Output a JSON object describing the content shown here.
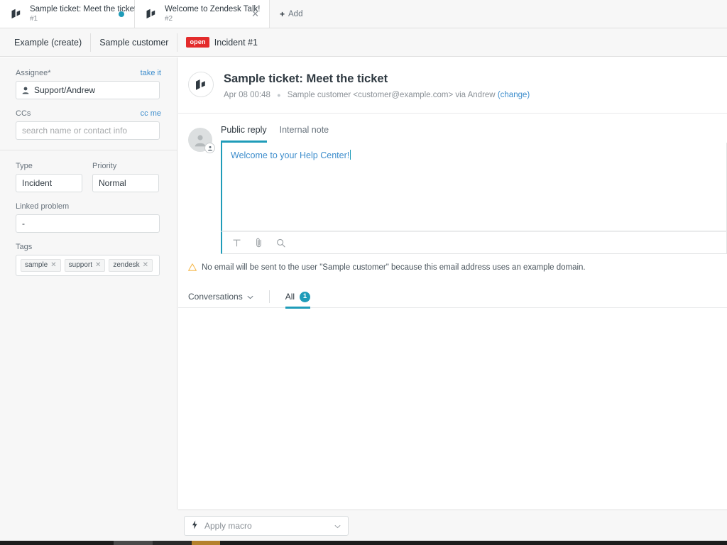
{
  "tabs": [
    {
      "title": "Sample ticket: Meet the ticket",
      "number": "#1",
      "icon": "ticket-icon",
      "state": "active",
      "indicator": "unsaved-dot"
    },
    {
      "title": "Welcome to Zendesk Talk!",
      "number": "#2",
      "icon": "ticket-icon",
      "state": "inactive",
      "indicator": "close-icon"
    }
  ],
  "add_tab": {
    "label": "Add",
    "icon": "plus-icon"
  },
  "breadcrumbs": [
    {
      "label": "Example (create)",
      "badge": null
    },
    {
      "label": "Sample customer",
      "badge": null
    },
    {
      "label": "Incident #1",
      "badge": "open"
    }
  ],
  "sidebar": {
    "assignee": {
      "label": "Assignee*",
      "action": "take it",
      "value": "Support/Andrew",
      "icon": "person-icon"
    },
    "ccs": {
      "label": "CCs",
      "action": "cc me",
      "value": "",
      "placeholder": "search name or contact info"
    },
    "type": {
      "label": "Type",
      "value": "Incident"
    },
    "priority": {
      "label": "Priority",
      "value": "Normal"
    },
    "linked_problem": {
      "label": "Linked problem",
      "value": "-"
    },
    "tags": {
      "label": "Tags",
      "chips": [
        "sample",
        "support",
        "zendesk"
      ]
    }
  },
  "ticket": {
    "title": "Sample ticket: Meet the ticket",
    "timestamp": "Apr 08 00:48",
    "requester": "Sample customer <customer@example.com> via Andrew",
    "change_link": "(change)",
    "avatar_icon": "ticket-icon"
  },
  "composer": {
    "tabs": [
      {
        "label": "Public reply",
        "active": true
      },
      {
        "label": "Internal note",
        "active": false
      }
    ],
    "body_text": "Welcome to your Help Center!",
    "toolbar_icons": [
      "text-format-icon",
      "attachment-icon",
      "search-icon"
    ],
    "avatar_icon": "user-avatar-icon",
    "avatar_badge_icon": "end-user-icon"
  },
  "warning": {
    "icon": "warning-triangle-icon",
    "text": "No email will be sent to the user \"Sample customer\" because this email address uses an example domain."
  },
  "conversations": {
    "selector_label": "Conversations",
    "selector_icon": "chevron-down-icon",
    "tab_label": "All",
    "tab_count": "1"
  },
  "footer": {
    "macro": {
      "label": "Apply macro",
      "icon": "lightning-icon",
      "chevron": "chevron-down-icon"
    }
  },
  "colors": {
    "accent_teal": "#1f9cb9",
    "link_blue": "#3d8dcc",
    "open_red": "#e32b2b",
    "warning_amber": "#f5b544",
    "text_dark": "#2f3941",
    "text_muted": "#68737d",
    "panel_bg": "#f7f7f7"
  }
}
